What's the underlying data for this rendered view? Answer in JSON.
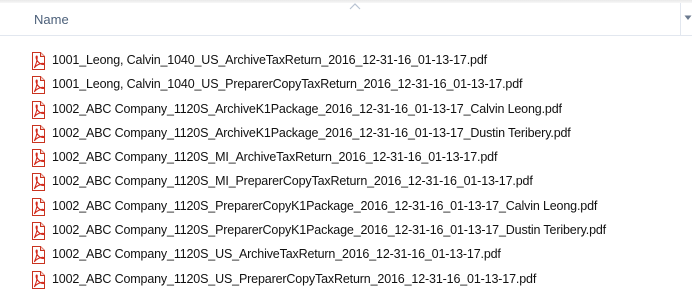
{
  "header": {
    "name_column": "Name"
  },
  "files": [
    "1001_Leong, Calvin_1040_US_ArchiveTaxReturn_2016_12-31-16_01-13-17.pdf",
    "1001_Leong, Calvin_1040_US_PreparerCopyTaxReturn_2016_12-31-16_01-13-17.pdf",
    "1002_ABC Company_1120S_ArchiveK1Package_2016_12-31-16_01-13-17_Calvin Leong.pdf",
    "1002_ABC Company_1120S_ArchiveK1Package_2016_12-31-16_01-13-17_Dustin Teribery.pdf",
    "1002_ABC Company_1120S_MI_ArchiveTaxReturn_2016_12-31-16_01-13-17.pdf",
    "1002_ABC Company_1120S_MI_PreparerCopyTaxReturn_2016_12-31-16_01-13-17.pdf",
    "1002_ABC Company_1120S_PreparerCopyK1Package_2016_12-31-16_01-13-17_Calvin Leong.pdf",
    "1002_ABC Company_1120S_PreparerCopyK1Package_2016_12-31-16_01-13-17_Dustin Teribery.pdf",
    "1002_ABC Company_1120S_US_ArchiveTaxReturn_2016_12-31-16_01-13-17.pdf",
    "1002_ABC Company_1120S_US_PreparerCopyTaxReturn_2016_12-31-16_01-13-17.pdf"
  ],
  "icons": {
    "file_icon": "pdf-icon",
    "sort_indicator": "sort-ascending-icon",
    "column_menu": "chevron-down-icon"
  },
  "colors": {
    "header_text": "#4c607a",
    "pdf_red": "#d42a1c",
    "file_text": "#111111"
  }
}
